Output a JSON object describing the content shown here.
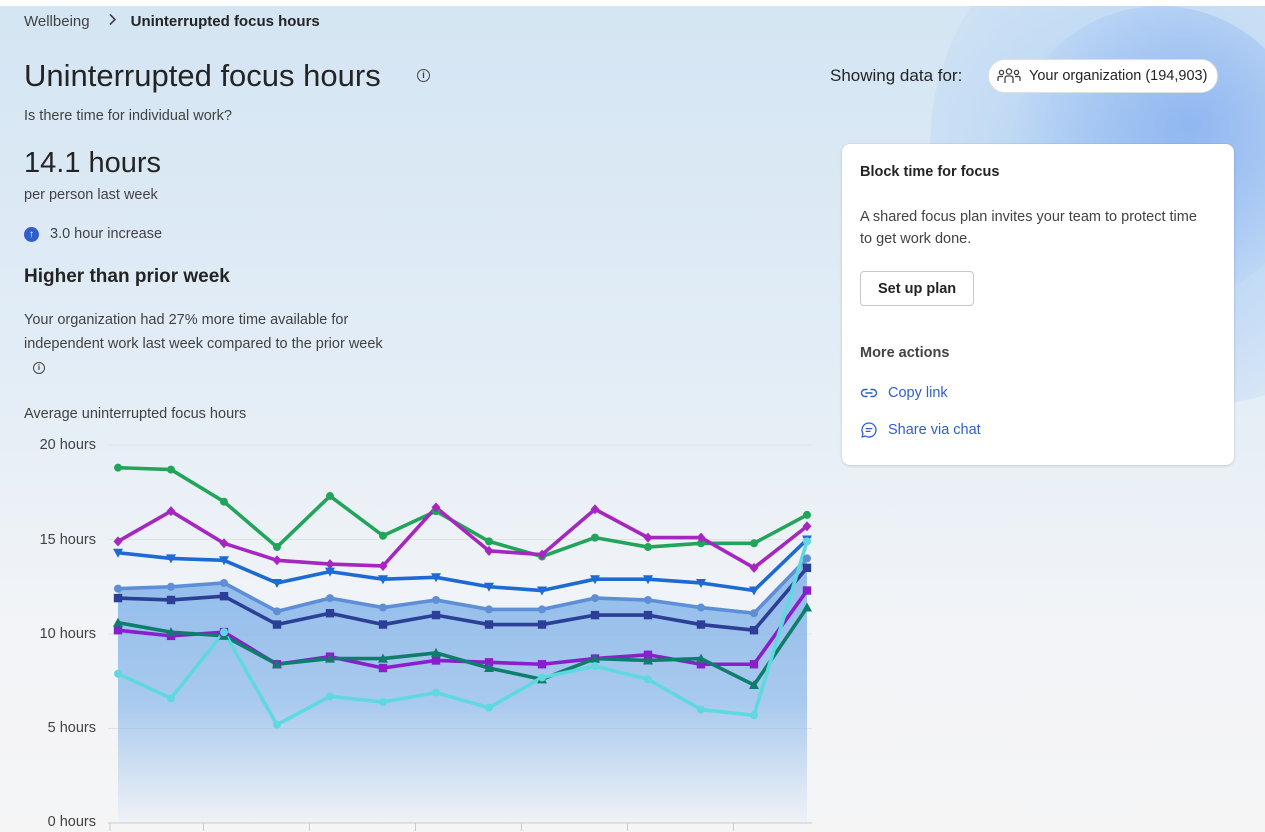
{
  "breadcrumb": {
    "root": "Wellbeing",
    "current": "Uninterrupted focus hours"
  },
  "page": {
    "title": "Uninterrupted focus hours",
    "subtitle": "Is there time for individual work?",
    "value": "14.1 hours",
    "value_label": "per person last week",
    "change": "3.0 hour increase",
    "heading": "Higher than prior week",
    "description": "Your organization had 27% more time available for independent work last week compared to the prior week"
  },
  "filter": {
    "label": "Showing data for:",
    "org": "Your organization (194,903)"
  },
  "card": {
    "title": "Block time for focus",
    "text": "A shared focus plan invites your team to protect time to get work done.",
    "button": "Set up plan",
    "more_actions": "More actions",
    "copy_link": "Copy link",
    "share_chat": "Share via chat"
  },
  "colors": {
    "accent": "#2f5fc9",
    "area": "#8ab8ea"
  },
  "chart_data": {
    "type": "line",
    "title": "Average uninterrupted focus hours",
    "y_ticks": [
      "20 hours",
      "15 hours",
      "10 hours",
      "5 hours",
      "0 hours"
    ],
    "ylim": [
      0,
      20
    ],
    "points": 14,
    "series": [
      {
        "color": "#22a45a",
        "marker": "circle",
        "values": [
          18.8,
          18.7,
          17.0,
          14.6,
          17.3,
          15.2,
          16.5,
          14.9,
          14.1,
          15.1,
          14.6,
          14.8,
          14.8,
          16.3
        ]
      },
      {
        "color": "#a626c0",
        "marker": "diamond",
        "values": [
          14.9,
          16.5,
          14.8,
          13.9,
          13.7,
          13.6,
          16.7,
          14.4,
          14.2,
          16.6,
          15.1,
          15.1,
          13.5,
          15.7
        ]
      },
      {
        "color": "#1e6ad3",
        "marker": "triangle-down",
        "values": [
          14.3,
          14.0,
          13.9,
          12.7,
          13.3,
          12.9,
          13.0,
          12.5,
          12.3,
          12.9,
          12.9,
          12.7,
          12.3,
          15.0
        ]
      },
      {
        "color": "#5e8fd6",
        "marker": "circle",
        "values": [
          12.4,
          12.5,
          12.7,
          11.2,
          11.9,
          11.4,
          11.8,
          11.3,
          11.3,
          11.9,
          11.8,
          11.4,
          11.1,
          14.0
        ]
      },
      {
        "color": "#2c3e95",
        "marker": "square",
        "values": [
          11.9,
          11.8,
          12.0,
          10.5,
          11.1,
          10.5,
          11.0,
          10.5,
          10.5,
          11.0,
          11.0,
          10.5,
          10.2,
          13.5
        ]
      },
      {
        "color": "#8a1ecc",
        "marker": "square",
        "values": [
          10.2,
          9.9,
          10.1,
          8.4,
          8.8,
          8.2,
          8.6,
          8.5,
          8.4,
          8.7,
          8.9,
          8.4,
          8.4,
          12.3
        ]
      },
      {
        "color": "#0e7e6c",
        "marker": "triangle",
        "values": [
          10.6,
          10.1,
          9.9,
          8.4,
          8.7,
          8.7,
          9.0,
          8.2,
          7.6,
          8.7,
          8.6,
          8.7,
          7.3,
          11.4
        ]
      },
      {
        "color": "#5fd9df",
        "marker": "circle",
        "values": [
          7.9,
          6.6,
          10.1,
          5.2,
          6.7,
          6.4,
          6.9,
          6.1,
          7.7,
          8.3,
          7.6,
          6.0,
          5.7,
          14.9
        ]
      }
    ],
    "area_series_index": 3
  }
}
